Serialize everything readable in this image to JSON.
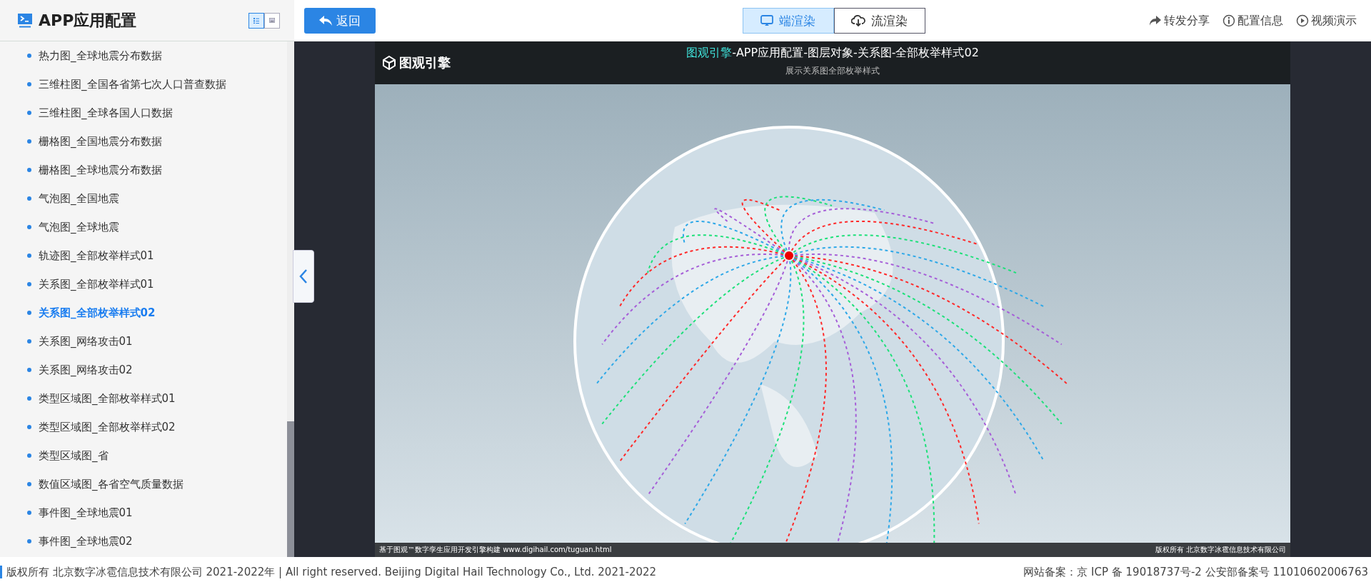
{
  "sidebar": {
    "title": "APP应用配置",
    "view_toggle": [
      {
        "selected": true
      },
      {
        "selected": false
      }
    ],
    "items": [
      {
        "label": "热力图_全球地震分布数据",
        "selected": false
      },
      {
        "label": "三维柱图_全国各省第七次人口普查数据",
        "selected": false
      },
      {
        "label": "三维柱图_全球各国人口数据",
        "selected": false
      },
      {
        "label": "栅格图_全国地震分布数据",
        "selected": false
      },
      {
        "label": "栅格图_全球地震分布数据",
        "selected": false
      },
      {
        "label": "气泡图_全国地震",
        "selected": false
      },
      {
        "label": "气泡图_全球地震",
        "selected": false
      },
      {
        "label": "轨迹图_全部枚举样式01",
        "selected": false
      },
      {
        "label": "关系图_全部枚举样式01",
        "selected": false
      },
      {
        "label": "关系图_全部枚举样式02",
        "selected": true
      },
      {
        "label": "关系图_网络攻击01",
        "selected": false
      },
      {
        "label": "关系图_网络攻击02",
        "selected": false
      },
      {
        "label": "类型区域图_全部枚举样式01",
        "selected": false
      },
      {
        "label": "类型区域图_全部枚举样式02",
        "selected": false
      },
      {
        "label": "类型区域图_省",
        "selected": false
      },
      {
        "label": "数值区域图_各省空气质量数据",
        "selected": false
      },
      {
        "label": "事件图_全球地震01",
        "selected": false
      },
      {
        "label": "事件图_全球地震02",
        "selected": false
      }
    ]
  },
  "toolbar": {
    "back_button": "返回",
    "render_modes": [
      {
        "label": "端渲染",
        "selected": true
      },
      {
        "label": "流渲染",
        "selected": false
      }
    ],
    "links": [
      {
        "kind": "share",
        "label": "转发分享"
      },
      {
        "kind": "info",
        "label": "配置信息"
      },
      {
        "kind": "video",
        "label": "视频演示"
      }
    ]
  },
  "viewer": {
    "brand": "图观引擎",
    "title_brand": "图观引擎",
    "title": "-APP应用配置-图层对象-关系图-全部枚举样式02",
    "subtitle": "展示关系图全部枚举样式",
    "footer_left": "基于图观™数字孪生应用开发引擎构建 www.digihail.com/tuguan.html",
    "footer_right": "版权所有 北京数字冰雹信息技术有限公司"
  },
  "footer": {
    "copyright": "版权所有 北京数字冰雹信息技术有限公司 2021-2022年 | All right reserved. Beijing Digital Hail Technology Co., Ltd. 2021-2022",
    "registration": "网站备案：京 ICP 备 19018737号-2 公安部备案号 11010602006763"
  }
}
